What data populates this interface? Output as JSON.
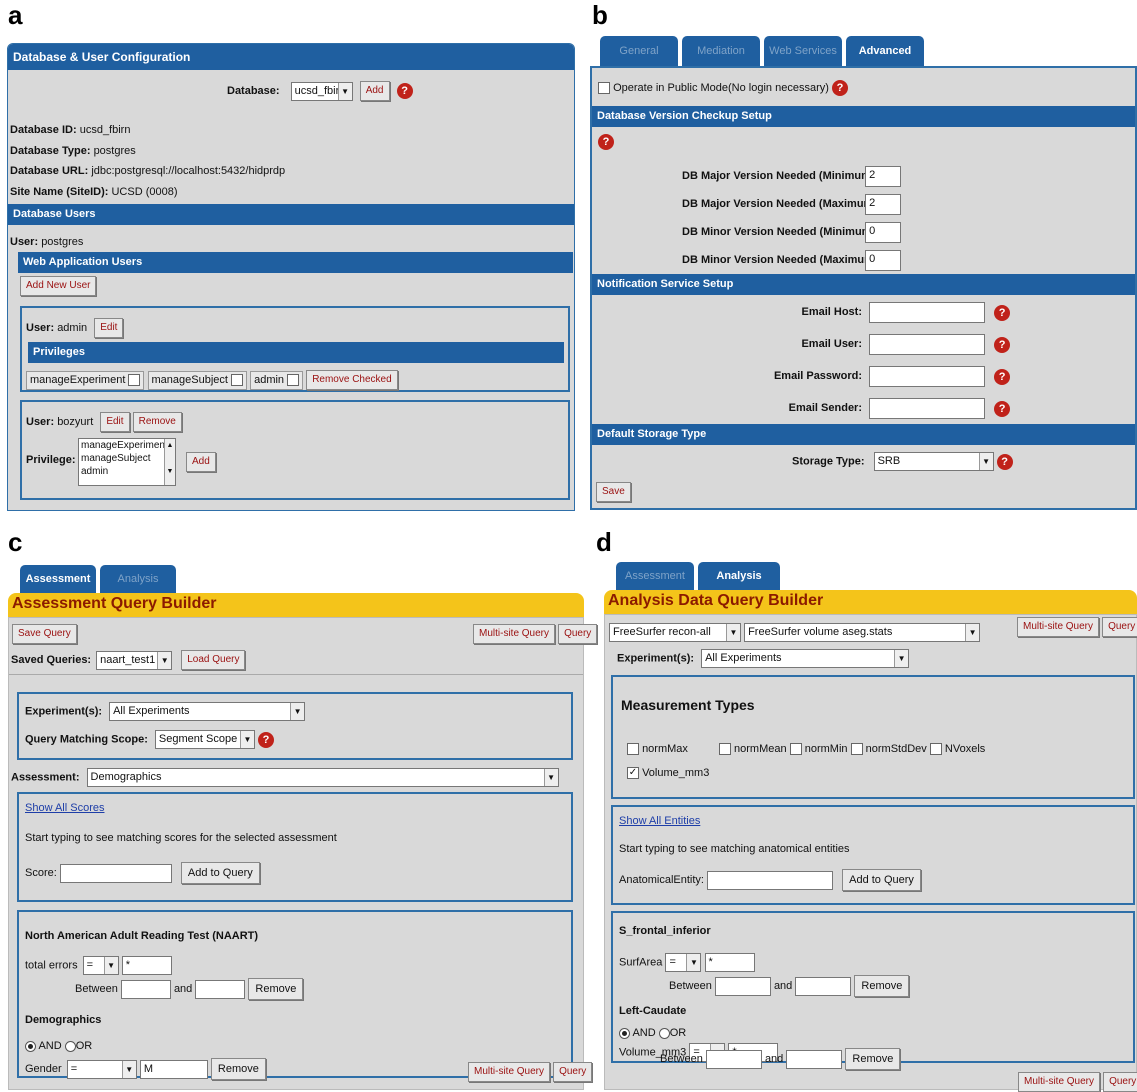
{
  "labels": {
    "a": "a",
    "b": "b",
    "c": "c",
    "d": "d"
  },
  "a": {
    "title": "Database & User Configuration",
    "database_label": "Database:",
    "database_value": "ucsd_fbirn",
    "add": "Add",
    "db_id_label": "Database ID:",
    "db_id": "ucsd_fbirn",
    "db_type_label": "Database Type:",
    "db_type": "postgres",
    "db_url_label": "Database URL:",
    "db_url": "jdbc:postgresql://localhost:5432/hidprdp",
    "site_label": "Site Name (SiteID):",
    "site": "UCSD (0008)",
    "db_users": "Database Users",
    "user_label": "User:",
    "user": "postgres",
    "web_users": "Web Application Users",
    "add_new_user": "Add New User",
    "user1": "admin",
    "edit": "Edit",
    "privileges": "Privileges",
    "priv1": "manageExperiment",
    "priv2": "manageSubject",
    "priv3": "admin",
    "remove_checked": "Remove Checked",
    "user2": "bozyurt",
    "remove": "Remove",
    "privilege_label": "Privilege:",
    "priv_list": [
      "manageExperiment",
      "manageSubject",
      "admin"
    ]
  },
  "b": {
    "tabs": [
      "General",
      "Mediation",
      "Web Services",
      "Advanced"
    ],
    "public_mode": "Operate in Public Mode(No login necessary)",
    "version_section": "Database Version Checkup Setup",
    "v1": "DB Major Version Needed (Minimum):",
    "v1val": "2",
    "v2": "DB Major Version Needed (Maximum):",
    "v2val": "2",
    "v3": "DB Minor Version Needed (Minimum):",
    "v3val": "0",
    "v4": "DB Minor Version Needed (Maximum):",
    "v4val": "0",
    "notif_section": "Notification Service Setup",
    "host": "Email Host:",
    "user": "Email User:",
    "password": "Email Password:",
    "sender": "Email Sender:",
    "storage_section": "Default Storage Type",
    "storage_label": "Storage Type:",
    "storage_value": "SRB",
    "save": "Save"
  },
  "c": {
    "tabs": [
      "Assessment",
      "Analysis"
    ],
    "title": "Assessment Query Builder",
    "save_query": "Save Query",
    "multisite": "Multi-site Query",
    "query": "Query",
    "saved_label": "Saved Queries:",
    "saved_value": "naart_test1",
    "load": "Load Query",
    "exp_label": "Experiment(s):",
    "exp_value": "All Experiments",
    "scope_label": "Query Matching Scope:",
    "scope_value": "Segment Scope",
    "assess_label": "Assessment:",
    "assess_value": "Demographics",
    "show_scores": "Show All Scores",
    "hint": "Start typing to see matching scores for the selected assessment",
    "score_label": "Score:",
    "add_to_query": "Add to Query",
    "naart": "North American Adult Reading Test (NAART)",
    "total_errors": "total errors",
    "eq": "=",
    "star": "*",
    "between": "Between",
    "and": "and",
    "remove": "Remove",
    "demographics": "Demographics",
    "and_op": "AND",
    "or_op": "OR",
    "gender": "Gender",
    "gender_val": "M"
  },
  "d": {
    "tabs": [
      "Assessment",
      "Analysis"
    ],
    "title": "Analysis Data Query Builder",
    "pipeline": "FreeSurfer recon-all",
    "file": "FreeSurfer volume aseg.stats",
    "multisite": "Multi-site Query",
    "query": "Query",
    "exp_label": "Experiment(s):",
    "exp_value": "All Experiments",
    "mtypes": "Measurement Types",
    "m1": "normMax",
    "m2": "normMean",
    "m3": "normMin",
    "m4": "normStdDev",
    "m5": "NVoxels",
    "m6": "Volume_mm3",
    "show_entities": "Show All Entities",
    "hint": "Start typing to see matching anatomical entities",
    "entity_label": "AnatomicalEntity:",
    "add_to_query": "Add to Query",
    "e1": "S_frontal_inferior",
    "surf": "SurfArea",
    "eq": "=",
    "star": "*",
    "between": "Between",
    "and": "and",
    "remove": "Remove",
    "e2": "Left-Caudate",
    "and_op": "AND",
    "or_op": "OR",
    "vol": "Volume_mm3"
  }
}
